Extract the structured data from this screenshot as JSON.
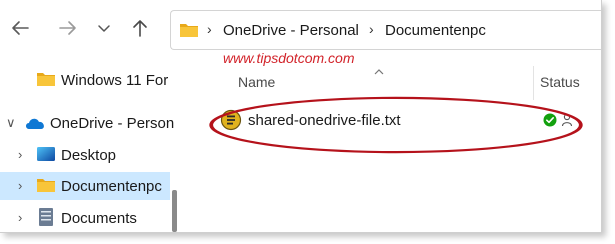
{
  "toolbar": {
    "back_icon": "arrow-left-icon",
    "forward_icon": "arrow-right-icon",
    "recent_icon": "chevron-down-icon",
    "up_icon": "arrow-up-icon"
  },
  "address_bar": {
    "segments": [
      "OneDrive - Personal",
      "Documentenpc"
    ]
  },
  "watermark": "www.tipsdotcom.com",
  "nav_pane": {
    "items": [
      {
        "label": "Windows 11 For",
        "icon": "folder-icon"
      },
      {
        "label": "OneDrive - Person",
        "icon": "cloud-icon"
      },
      {
        "label": "Desktop",
        "icon": "desktop-icon"
      },
      {
        "label": "Documentenpc",
        "icon": "folder-icon",
        "selected": true
      },
      {
        "label": "Documents",
        "icon": "document-icon"
      }
    ]
  },
  "content": {
    "columns": {
      "name": "Name",
      "status": "Status"
    },
    "files": [
      {
        "name": "shared-onedrive-file.txt",
        "icon": "text-file-icon",
        "status": [
          "synced-icon",
          "shared-icon"
        ]
      }
    ]
  },
  "colors": {
    "accent": "#0067c0",
    "selected_bg": "#cce8ff",
    "highlight": "#b5121b",
    "synced": "#13a10e",
    "folder": "#f8c53a"
  }
}
